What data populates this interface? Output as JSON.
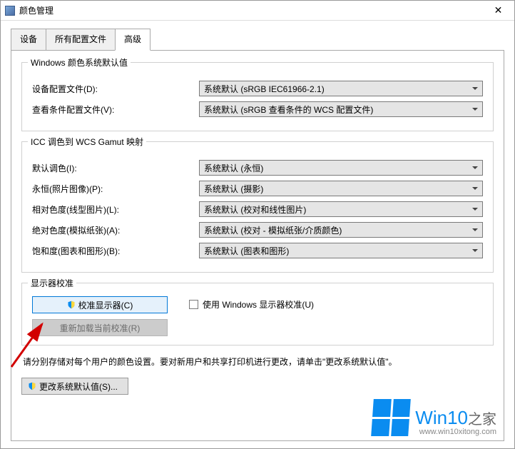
{
  "window": {
    "title": "颜色管理"
  },
  "tabs": {
    "devices": "设备",
    "allProfiles": "所有配置文件",
    "advanced": "高级"
  },
  "group1": {
    "legend": "Windows 颜色系统默认值",
    "deviceProfileLabel": "设备配置文件(D):",
    "deviceProfileValue": "系统默认 (sRGB IEC61966-2.1)",
    "viewingCondLabel": "查看条件配置文件(V):",
    "viewingCondValue": "系统默认 (sRGB 查看条件的 WCS 配置文件)"
  },
  "group2": {
    "legend": "ICC 调色到 WCS Gamut 映射",
    "defaultIntentLabel": "默认调色(I):",
    "defaultIntentValue": "系统默认 (永恒)",
    "perceptualLabel": "永恒(照片图像)(P):",
    "perceptualValue": "系统默认 (摄影)",
    "relativeLabel": "相对色度(线型图片)(L):",
    "relativeValue": "系统默认 (校对和线性图片)",
    "absoluteLabel": "绝对色度(模拟纸张)(A):",
    "absoluteValue": "系统默认 (校对 - 模拟纸张/介质颜色)",
    "saturationLabel": "饱和度(图表和图形)(B):",
    "saturationValue": "系统默认 (图表和图形)"
  },
  "group3": {
    "legend": "显示器校准",
    "calibrateBtn": "校准显示器(C)",
    "reloadBtn": "重新加载当前校准(R)",
    "useWindowsCalib": "使用 Windows 显示器校准(U)"
  },
  "hint": "请分别存储对每个用户的颜色设置。要对新用户和共享打印机进行更改，请单击\"更改系统默认值\"。",
  "changeSystemDefaultsBtn": "更改系统默认值(S)...",
  "watermark": {
    "main": "Win10",
    "sub": "之家",
    "url": "www.win10xitong.com"
  }
}
